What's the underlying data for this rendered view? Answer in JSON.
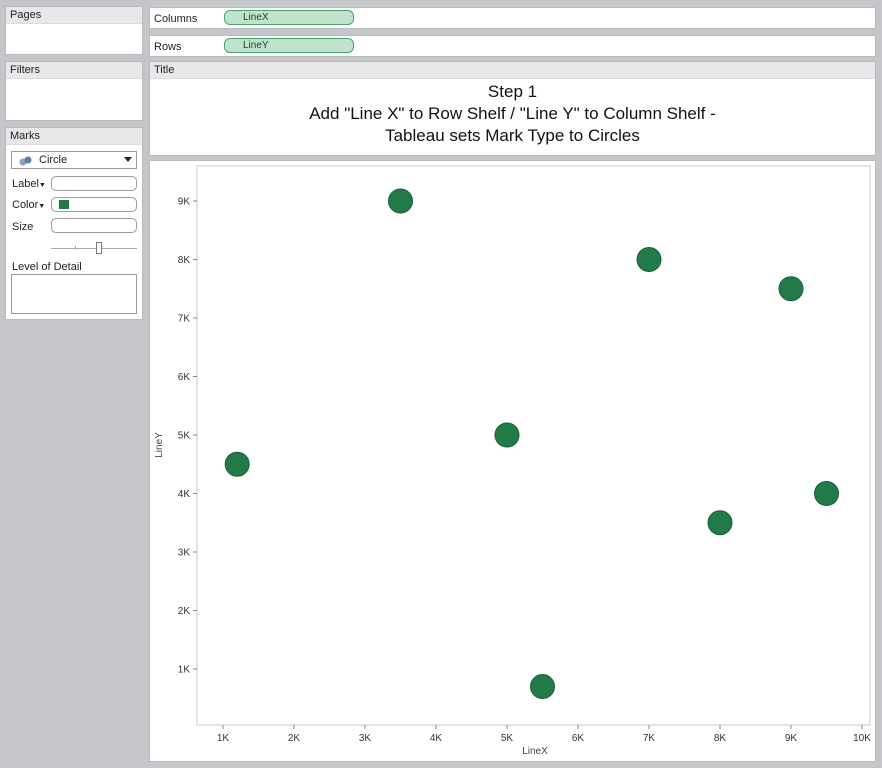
{
  "pages": {
    "header": "Pages"
  },
  "filters": {
    "header": "Filters"
  },
  "marks": {
    "header": "Marks",
    "type": "Circle",
    "label_label": "Label",
    "color_label": "Color",
    "size_label": "Size",
    "lod_label": "Level of Detail",
    "color_swatch": "#1f7a44"
  },
  "columns": {
    "label": "Columns",
    "pill": "LineX"
  },
  "rows": {
    "label": "Rows",
    "pill": "LineY"
  },
  "title": {
    "header": "Title",
    "line1": "Step 1",
    "line2": "Add \"Line X\" to Row Shelf / \"Line Y\" to Column Shelf -",
    "line3": "Tableau sets Mark Type to Circles"
  },
  "chart_data": {
    "type": "scatter",
    "xlabel": "LineX",
    "ylabel": "LineY",
    "xlim": [
      600,
      10000
    ],
    "ylim": [
      0,
      9600
    ],
    "xticks": [
      1000,
      2000,
      3000,
      4000,
      5000,
      6000,
      7000,
      8000,
      9000,
      10000
    ],
    "xtick_labels": [
      "1K",
      "2K",
      "3K",
      "4K",
      "5K",
      "6K",
      "7K",
      "8K",
      "9K",
      "10K"
    ],
    "yticks": [
      1000,
      2000,
      3000,
      4000,
      5000,
      6000,
      7000,
      8000,
      9000
    ],
    "ytick_labels": [
      "1K",
      "2K",
      "3K",
      "4K",
      "5K",
      "6K",
      "7K",
      "8K",
      "9K"
    ],
    "grid": false,
    "color": "#217a47",
    "points": [
      {
        "x": 1200,
        "y": 4500
      },
      {
        "x": 3500,
        "y": 9000
      },
      {
        "x": 5000,
        "y": 5000
      },
      {
        "x": 5500,
        "y": 700
      },
      {
        "x": 7000,
        "y": 8000
      },
      {
        "x": 8000,
        "y": 3500
      },
      {
        "x": 9000,
        "y": 7500
      },
      {
        "x": 9500,
        "y": 4000
      }
    ]
  }
}
